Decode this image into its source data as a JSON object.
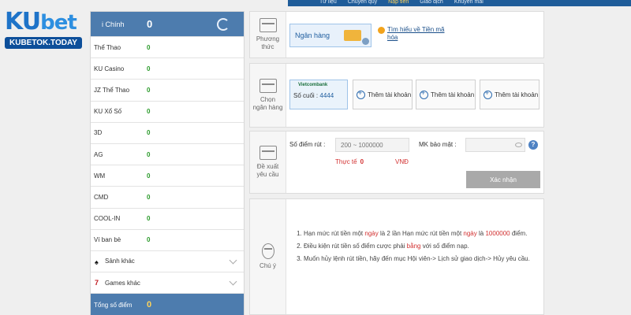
{
  "topnav": {
    "items": [
      "Tư liệu",
      "Chuyển quỹ",
      "Nạp tiền",
      "Giao dịch",
      "Khuyến mãi"
    ],
    "active_index": 2
  },
  "logo": {
    "brand": "KUbet",
    "ku": "KU",
    "bet": "bet",
    "tagline": "KUBETOK.TODAY"
  },
  "balances": {
    "main": {
      "label": "i Chính",
      "value": "0"
    },
    "items": [
      {
        "label": "Thể Thao",
        "value": "0"
      },
      {
        "label": "KU Casino",
        "value": "0"
      },
      {
        "label": "JZ Thể Thao",
        "value": "0"
      },
      {
        "label": "KU Xổ Số",
        "value": "0"
      },
      {
        "label": "3D",
        "value": "0"
      },
      {
        "label": "AG",
        "value": "0"
      },
      {
        "label": "WM",
        "value": "0"
      },
      {
        "label": "CMD",
        "value": "0"
      },
      {
        "label": "COOL-IN",
        "value": "0"
      },
      {
        "label": "Ví ban bè",
        "value": "0"
      }
    ],
    "other_halls": "Sảnh khác",
    "other_games": "Games khác",
    "total": {
      "label": "Tổng số điểm",
      "value": "0"
    }
  },
  "method": {
    "heading_line1": "Phương",
    "heading_line2": "thức",
    "option": "Ngân hàng",
    "help_line1": "Tìm hiểu về Tiền mã",
    "help_line2": "hóa"
  },
  "bank": {
    "heading_line1": "Chọn",
    "heading_line2": "ngân hàng",
    "card": {
      "bank_name": "Vietcombank",
      "last_label": "Số cuối :",
      "last_digits": "4444"
    },
    "add_labels": [
      "Thêm tài khoản",
      "Thêm tài khoản",
      "Thêm tài khoản"
    ]
  },
  "request": {
    "heading_line1": "Đề xuất",
    "heading_line2": "yêu cầu",
    "points_label": "Số điểm rút :",
    "points_placeholder": "200 ~ 1000000",
    "password_label": "MK bảo mật :",
    "real_label": "Thực tế",
    "real_value": "0",
    "currency": "VNĐ",
    "confirm": "Xác nhận"
  },
  "notes": {
    "heading": "Chú ý",
    "line1_a": "Hạn mức rút tiền một",
    "line1_day": "ngày",
    "line1_b": "là 2 lần Hạn mức rút tiền một",
    "line1_day2": "ngày",
    "line1_c": "là",
    "line1_amount": "1000000",
    "line1_d": "điểm.",
    "line2_a": "Điều kiện rút tiền số điểm cược phải",
    "line2_eq": "bằng",
    "line2_b": "với số điểm nạp.",
    "line3": "Muốn hủy lệnh rút tiền, hãy đến mục Hội viên-> Lịch sử giao dịch-> Hủy yêu cầu."
  }
}
